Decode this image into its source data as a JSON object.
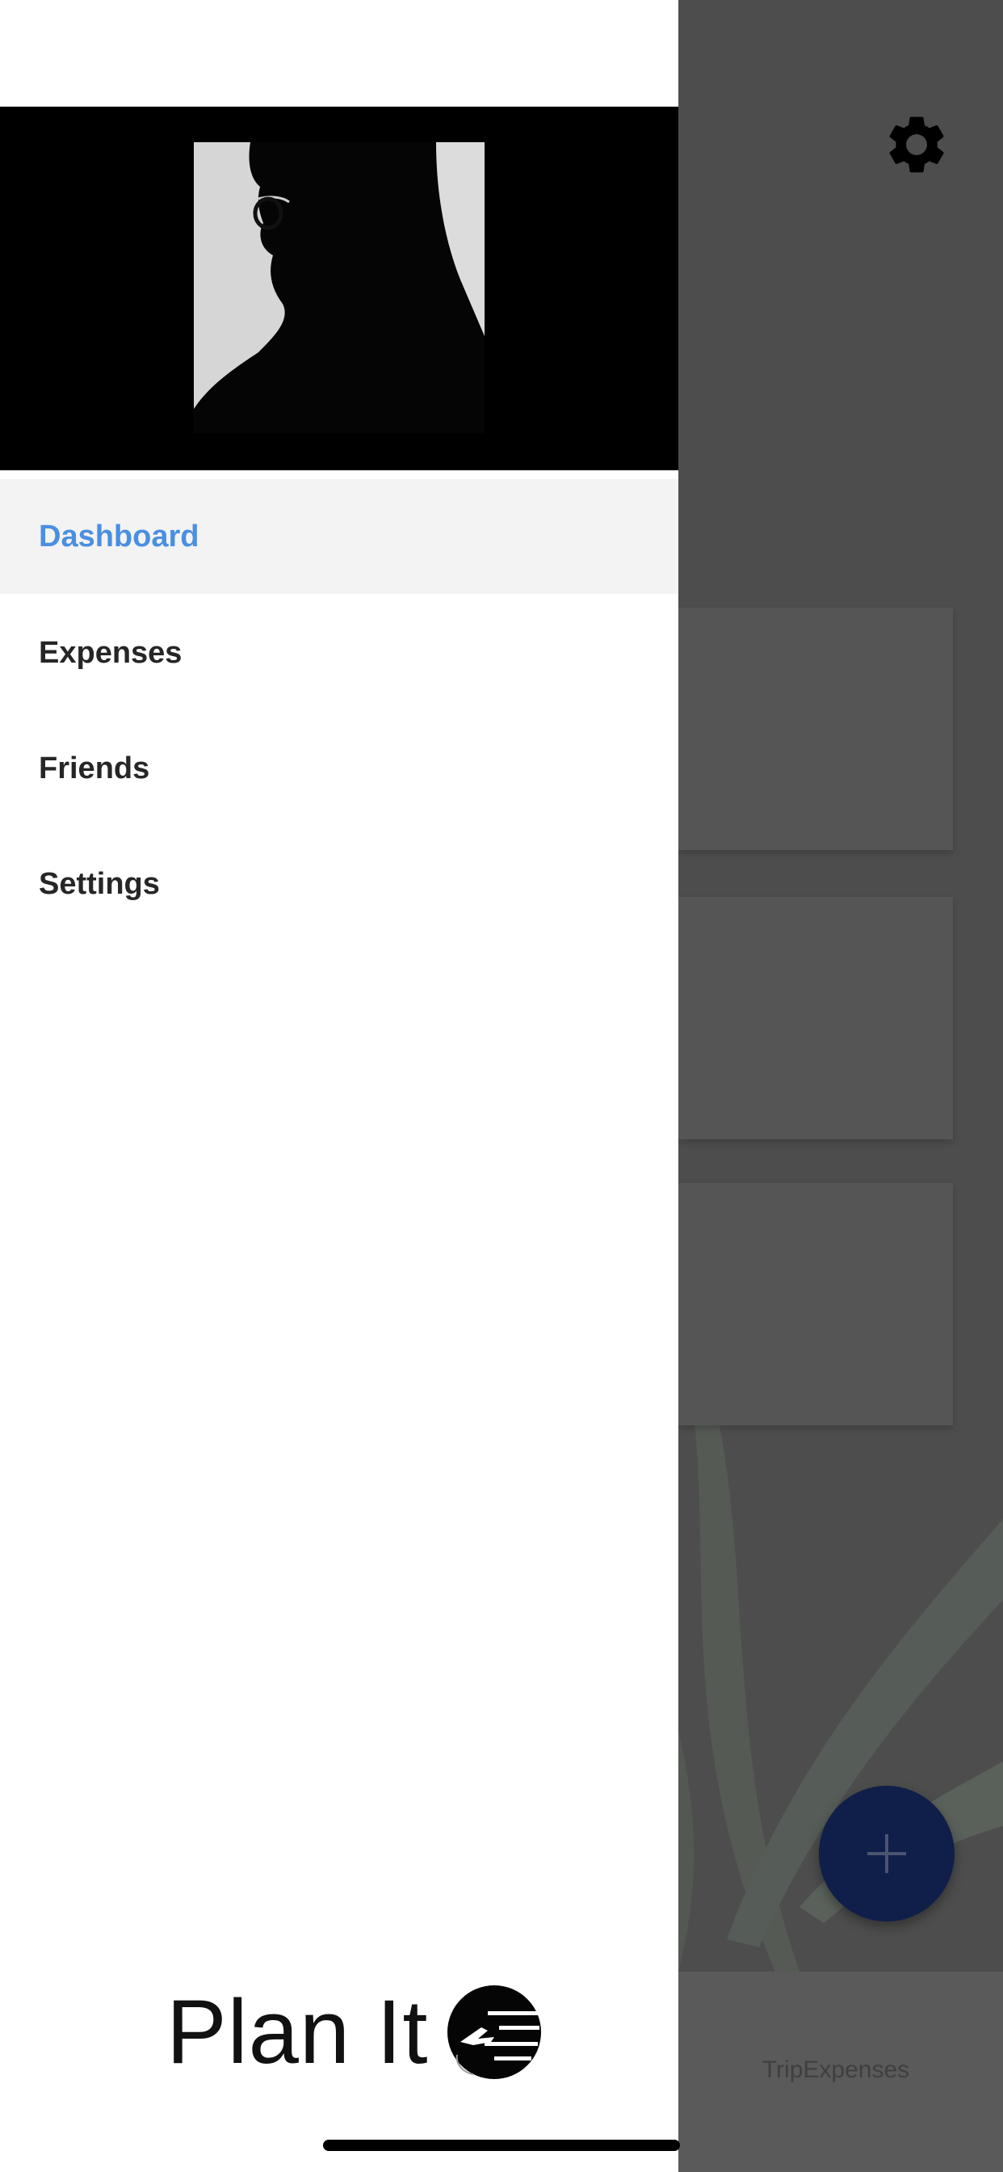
{
  "drawer": {
    "menu": [
      {
        "label": "Dashboard",
        "active": true
      },
      {
        "label": "Expenses",
        "active": false
      },
      {
        "label": "Friends",
        "active": false
      },
      {
        "label": "Settings",
        "active": false
      }
    ],
    "brand": {
      "name": "Plan It",
      "logo_icon": "airplane-globe-icon"
    }
  },
  "background": {
    "settings_icon": "gear-icon",
    "fab_icon": "plus-icon",
    "tab_label": "TripExpenses"
  },
  "colors": {
    "active_menu": "#4a8fe0",
    "fab": "#0f1f4a",
    "overlay": "#4d4d4d"
  }
}
